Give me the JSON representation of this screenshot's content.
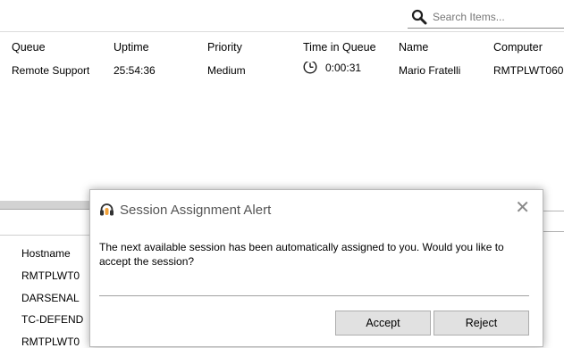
{
  "search": {
    "placeholder": "Search Items..."
  },
  "queue_table": {
    "columns": [
      "Queue",
      "Uptime",
      "Priority",
      "Time in Queue",
      "Name",
      "Computer"
    ],
    "rows": [
      {
        "queue": "Remote Support",
        "uptime": "25:54:36",
        "priority": "Medium",
        "time_in_queue": "0:00:31",
        "name": "Mario Fratelli",
        "computer": "RMTPLWT060"
      }
    ]
  },
  "lower_table": {
    "header": "Hostname",
    "rows": [
      "RMTPLWT0",
      "DARSENAL",
      "TC-DEFEND",
      "RMTPLWT0"
    ]
  },
  "dialog": {
    "title": "Session Assignment Alert",
    "close_symbol": "✕",
    "message": "The next available session has been automatically assigned to you.  Would you like to accept the session?",
    "accept_label": "Accept",
    "reject_label": "Reject"
  },
  "colors": {
    "background": "#ffffff",
    "button_bg": "#e1e1e1",
    "button_border": "#adadad"
  },
  "icons": {
    "search": "magnifier-icon",
    "clock": "clock-icon",
    "dialog": "headset-icon"
  }
}
